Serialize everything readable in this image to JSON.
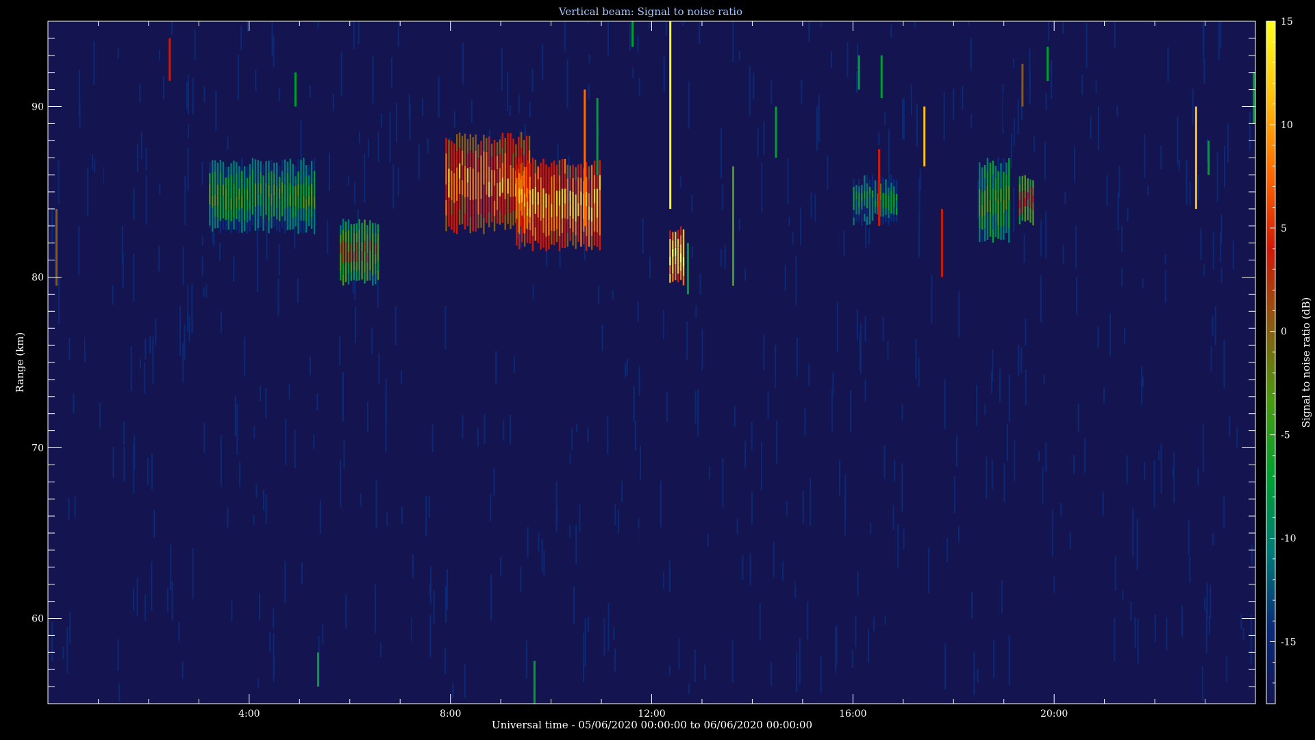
{
  "chart_data": {
    "type": "heatmap",
    "title": "Vertical beam: Signal to noise ratio",
    "xlabel": "Universal time - 05/06/2020 00:00:00 to 06/06/2020 00:00:00",
    "ylabel": "Range (km)",
    "colorbar_label": "Signal to noise ratio (dB)",
    "xlim": [
      0,
      24
    ],
    "ylim": [
      55,
      95
    ],
    "clim": [
      -18,
      15
    ],
    "x_ticks": [
      {
        "value": 4,
        "label": "4:00"
      },
      {
        "value": 8,
        "label": "8:00"
      },
      {
        "value": 12,
        "label": "12:00"
      },
      {
        "value": 16,
        "label": "16:00"
      },
      {
        "value": 20,
        "label": "20:00"
      }
    ],
    "y_ticks": [
      {
        "value": 60,
        "label": "60"
      },
      {
        "value": 70,
        "label": "70"
      },
      {
        "value": 80,
        "label": "80"
      },
      {
        "value": 90,
        "label": "90"
      }
    ],
    "colorbar_ticks": [
      {
        "value": -15,
        "label": "-15"
      },
      {
        "value": -10,
        "label": "-10"
      },
      {
        "value": -5,
        "label": "-5"
      },
      {
        "value": 0,
        "label": "0"
      },
      {
        "value": 5,
        "label": "5"
      },
      {
        "value": 10,
        "label": "10"
      },
      {
        "value": 15,
        "label": "15"
      }
    ],
    "colormap": [
      "#141450",
      "#0a2a78",
      "#007a78",
      "#00a030",
      "#4a9a10",
      "#8a5a10",
      "#d01808",
      "#ff6a00",
      "#ffc010",
      "#ffff20"
    ],
    "background_level": -16,
    "echo_regions": [
      {
        "t_start": 3.2,
        "t_end": 5.3,
        "range_low": 82.5,
        "range_high": 87.0,
        "snr": -4
      },
      {
        "t_start": 5.8,
        "t_end": 6.6,
        "range_low": 79.5,
        "range_high": 83.5,
        "snr": 0
      },
      {
        "t_start": 7.9,
        "t_end": 9.6,
        "range_low": 82.5,
        "range_high": 88.5,
        "snr": 8
      },
      {
        "t_start": 9.3,
        "t_end": 11.0,
        "range_low": 81.5,
        "range_high": 87.0,
        "snr": 10
      },
      {
        "t_start": 12.35,
        "t_end": 12.65,
        "range_low": 79.5,
        "range_high": 83.0,
        "snr": 13
      },
      {
        "t_start": 16.0,
        "t_end": 16.9,
        "range_low": 83.0,
        "range_high": 86.0,
        "snr": -6
      },
      {
        "t_start": 18.5,
        "t_end": 19.1,
        "range_low": 82.0,
        "range_high": 87.0,
        "snr": -3
      },
      {
        "t_start": 19.3,
        "t_end": 19.6,
        "range_low": 83.0,
        "range_high": 86.0,
        "snr": 2
      }
    ],
    "spikes": [
      {
        "t": 2.4,
        "range_low": 91.5,
        "range_high": 94.0,
        "snr": 2
      },
      {
        "t": 0.15,
        "range_low": 79.5,
        "range_high": 84.0,
        "snr": 0
      },
      {
        "t": 4.9,
        "range_low": 90.0,
        "range_high": 92.0,
        "snr": -5
      },
      {
        "t": 5.35,
        "range_low": 56.0,
        "range_high": 58.0,
        "snr": -5
      },
      {
        "t": 9.65,
        "range_low": 55.0,
        "range_high": 57.5,
        "snr": -6
      },
      {
        "t": 10.65,
        "range_low": 83.0,
        "range_high": 91.0,
        "snr": 8
      },
      {
        "t": 10.9,
        "range_low": 86.0,
        "range_high": 90.5,
        "snr": -5
      },
      {
        "t": 11.6,
        "range_low": 93.5,
        "range_high": 95.0,
        "snr": -5
      },
      {
        "t": 12.35,
        "range_low": 84.0,
        "range_high": 95.0,
        "snr": 12
      },
      {
        "t": 16.1,
        "range_low": 91.0,
        "range_high": 93.0,
        "snr": -6
      },
      {
        "t": 16.5,
        "range_low": 83.0,
        "range_high": 87.5,
        "snr": 4
      },
      {
        "t": 16.55,
        "range_low": 90.5,
        "range_high": 93.0,
        "snr": -5
      },
      {
        "t": 17.4,
        "range_low": 86.5,
        "range_high": 90.0,
        "snr": 9
      },
      {
        "t": 17.75,
        "range_low": 80.0,
        "range_high": 84.0,
        "snr": 2
      },
      {
        "t": 19.35,
        "range_low": 90.0,
        "range_high": 92.5,
        "snr": 1
      },
      {
        "t": 19.85,
        "range_low": 91.5,
        "range_high": 93.5,
        "snr": -6
      },
      {
        "t": 22.8,
        "range_low": 84.0,
        "range_high": 90.0,
        "snr": 10
      },
      {
        "t": 23.05,
        "range_low": 86.0,
        "range_high": 88.0,
        "snr": -5
      },
      {
        "t": 23.95,
        "range_low": 89.0,
        "range_high": 92.0,
        "snr": -6
      },
      {
        "t": 13.6,
        "range_low": 79.5,
        "range_high": 86.5,
        "snr": -2
      },
      {
        "t": 14.45,
        "range_low": 87.0,
        "range_high": 90.0,
        "snr": -6
      },
      {
        "t": 12.7,
        "range_low": 79.0,
        "range_high": 82.0,
        "snr": -5
      }
    ]
  }
}
